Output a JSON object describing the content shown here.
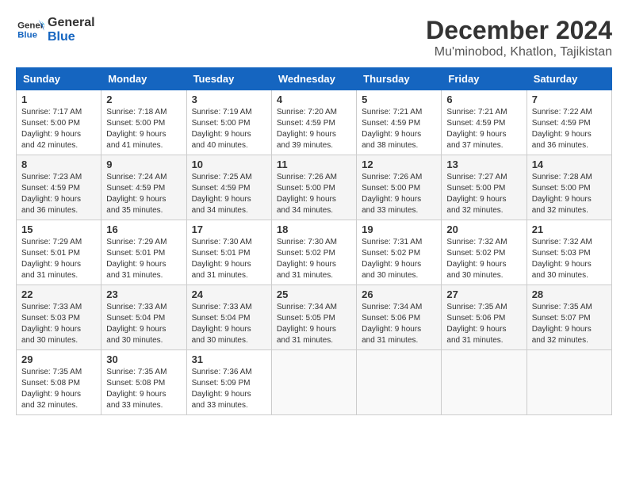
{
  "header": {
    "logo_line1": "General",
    "logo_line2": "Blue",
    "title": "December 2024",
    "subtitle": "Mu'minobod, Khatlon, Tajikistan"
  },
  "calendar": {
    "columns": [
      "Sunday",
      "Monday",
      "Tuesday",
      "Wednesday",
      "Thursday",
      "Friday",
      "Saturday"
    ],
    "weeks": [
      [
        null,
        null,
        null,
        null,
        null,
        null,
        null
      ]
    ],
    "days": {
      "1": {
        "sunrise": "Sunrise: 7:17 AM",
        "sunset": "Sunset: 5:00 PM",
        "daylight": "Daylight: 9 hours and 42 minutes."
      },
      "2": {
        "sunrise": "Sunrise: 7:18 AM",
        "sunset": "Sunset: 5:00 PM",
        "daylight": "Daylight: 9 hours and 41 minutes."
      },
      "3": {
        "sunrise": "Sunrise: 7:19 AM",
        "sunset": "Sunset: 5:00 PM",
        "daylight": "Daylight: 9 hours and 40 minutes."
      },
      "4": {
        "sunrise": "Sunrise: 7:20 AM",
        "sunset": "Sunset: 4:59 PM",
        "daylight": "Daylight: 9 hours and 39 minutes."
      },
      "5": {
        "sunrise": "Sunrise: 7:21 AM",
        "sunset": "Sunset: 4:59 PM",
        "daylight": "Daylight: 9 hours and 38 minutes."
      },
      "6": {
        "sunrise": "Sunrise: 7:21 AM",
        "sunset": "Sunset: 4:59 PM",
        "daylight": "Daylight: 9 hours and 37 minutes."
      },
      "7": {
        "sunrise": "Sunrise: 7:22 AM",
        "sunset": "Sunset: 4:59 PM",
        "daylight": "Daylight: 9 hours and 36 minutes."
      },
      "8": {
        "sunrise": "Sunrise: 7:23 AM",
        "sunset": "Sunset: 4:59 PM",
        "daylight": "Daylight: 9 hours and 36 minutes."
      },
      "9": {
        "sunrise": "Sunrise: 7:24 AM",
        "sunset": "Sunset: 4:59 PM",
        "daylight": "Daylight: 9 hours and 35 minutes."
      },
      "10": {
        "sunrise": "Sunrise: 7:25 AM",
        "sunset": "Sunset: 4:59 PM",
        "daylight": "Daylight: 9 hours and 34 minutes."
      },
      "11": {
        "sunrise": "Sunrise: 7:26 AM",
        "sunset": "Sunset: 5:00 PM",
        "daylight": "Daylight: 9 hours and 34 minutes."
      },
      "12": {
        "sunrise": "Sunrise: 7:26 AM",
        "sunset": "Sunset: 5:00 PM",
        "daylight": "Daylight: 9 hours and 33 minutes."
      },
      "13": {
        "sunrise": "Sunrise: 7:27 AM",
        "sunset": "Sunset: 5:00 PM",
        "daylight": "Daylight: 9 hours and 32 minutes."
      },
      "14": {
        "sunrise": "Sunrise: 7:28 AM",
        "sunset": "Sunset: 5:00 PM",
        "daylight": "Daylight: 9 hours and 32 minutes."
      },
      "15": {
        "sunrise": "Sunrise: 7:29 AM",
        "sunset": "Sunset: 5:01 PM",
        "daylight": "Daylight: 9 hours and 31 minutes."
      },
      "16": {
        "sunrise": "Sunrise: 7:29 AM",
        "sunset": "Sunset: 5:01 PM",
        "daylight": "Daylight: 9 hours and 31 minutes."
      },
      "17": {
        "sunrise": "Sunrise: 7:30 AM",
        "sunset": "Sunset: 5:01 PM",
        "daylight": "Daylight: 9 hours and 31 minutes."
      },
      "18": {
        "sunrise": "Sunrise: 7:30 AM",
        "sunset": "Sunset: 5:02 PM",
        "daylight": "Daylight: 9 hours and 31 minutes."
      },
      "19": {
        "sunrise": "Sunrise: 7:31 AM",
        "sunset": "Sunset: 5:02 PM",
        "daylight": "Daylight: 9 hours and 30 minutes."
      },
      "20": {
        "sunrise": "Sunrise: 7:32 AM",
        "sunset": "Sunset: 5:02 PM",
        "daylight": "Daylight: 9 hours and 30 minutes."
      },
      "21": {
        "sunrise": "Sunrise: 7:32 AM",
        "sunset": "Sunset: 5:03 PM",
        "daylight": "Daylight: 9 hours and 30 minutes."
      },
      "22": {
        "sunrise": "Sunrise: 7:33 AM",
        "sunset": "Sunset: 5:03 PM",
        "daylight": "Daylight: 9 hours and 30 minutes."
      },
      "23": {
        "sunrise": "Sunrise: 7:33 AM",
        "sunset": "Sunset: 5:04 PM",
        "daylight": "Daylight: 9 hours and 30 minutes."
      },
      "24": {
        "sunrise": "Sunrise: 7:33 AM",
        "sunset": "Sunset: 5:04 PM",
        "daylight": "Daylight: 9 hours and 30 minutes."
      },
      "25": {
        "sunrise": "Sunrise: 7:34 AM",
        "sunset": "Sunset: 5:05 PM",
        "daylight": "Daylight: 9 hours and 31 minutes."
      },
      "26": {
        "sunrise": "Sunrise: 7:34 AM",
        "sunset": "Sunset: 5:06 PM",
        "daylight": "Daylight: 9 hours and 31 minutes."
      },
      "27": {
        "sunrise": "Sunrise: 7:35 AM",
        "sunset": "Sunset: 5:06 PM",
        "daylight": "Daylight: 9 hours and 31 minutes."
      },
      "28": {
        "sunrise": "Sunrise: 7:35 AM",
        "sunset": "Sunset: 5:07 PM",
        "daylight": "Daylight: 9 hours and 32 minutes."
      },
      "29": {
        "sunrise": "Sunrise: 7:35 AM",
        "sunset": "Sunset: 5:08 PM",
        "daylight": "Daylight: 9 hours and 32 minutes."
      },
      "30": {
        "sunrise": "Sunrise: 7:35 AM",
        "sunset": "Sunset: 5:08 PM",
        "daylight": "Daylight: 9 hours and 33 minutes."
      },
      "31": {
        "sunrise": "Sunrise: 7:36 AM",
        "sunset": "Sunset: 5:09 PM",
        "daylight": "Daylight: 9 hours and 33 minutes."
      }
    }
  }
}
